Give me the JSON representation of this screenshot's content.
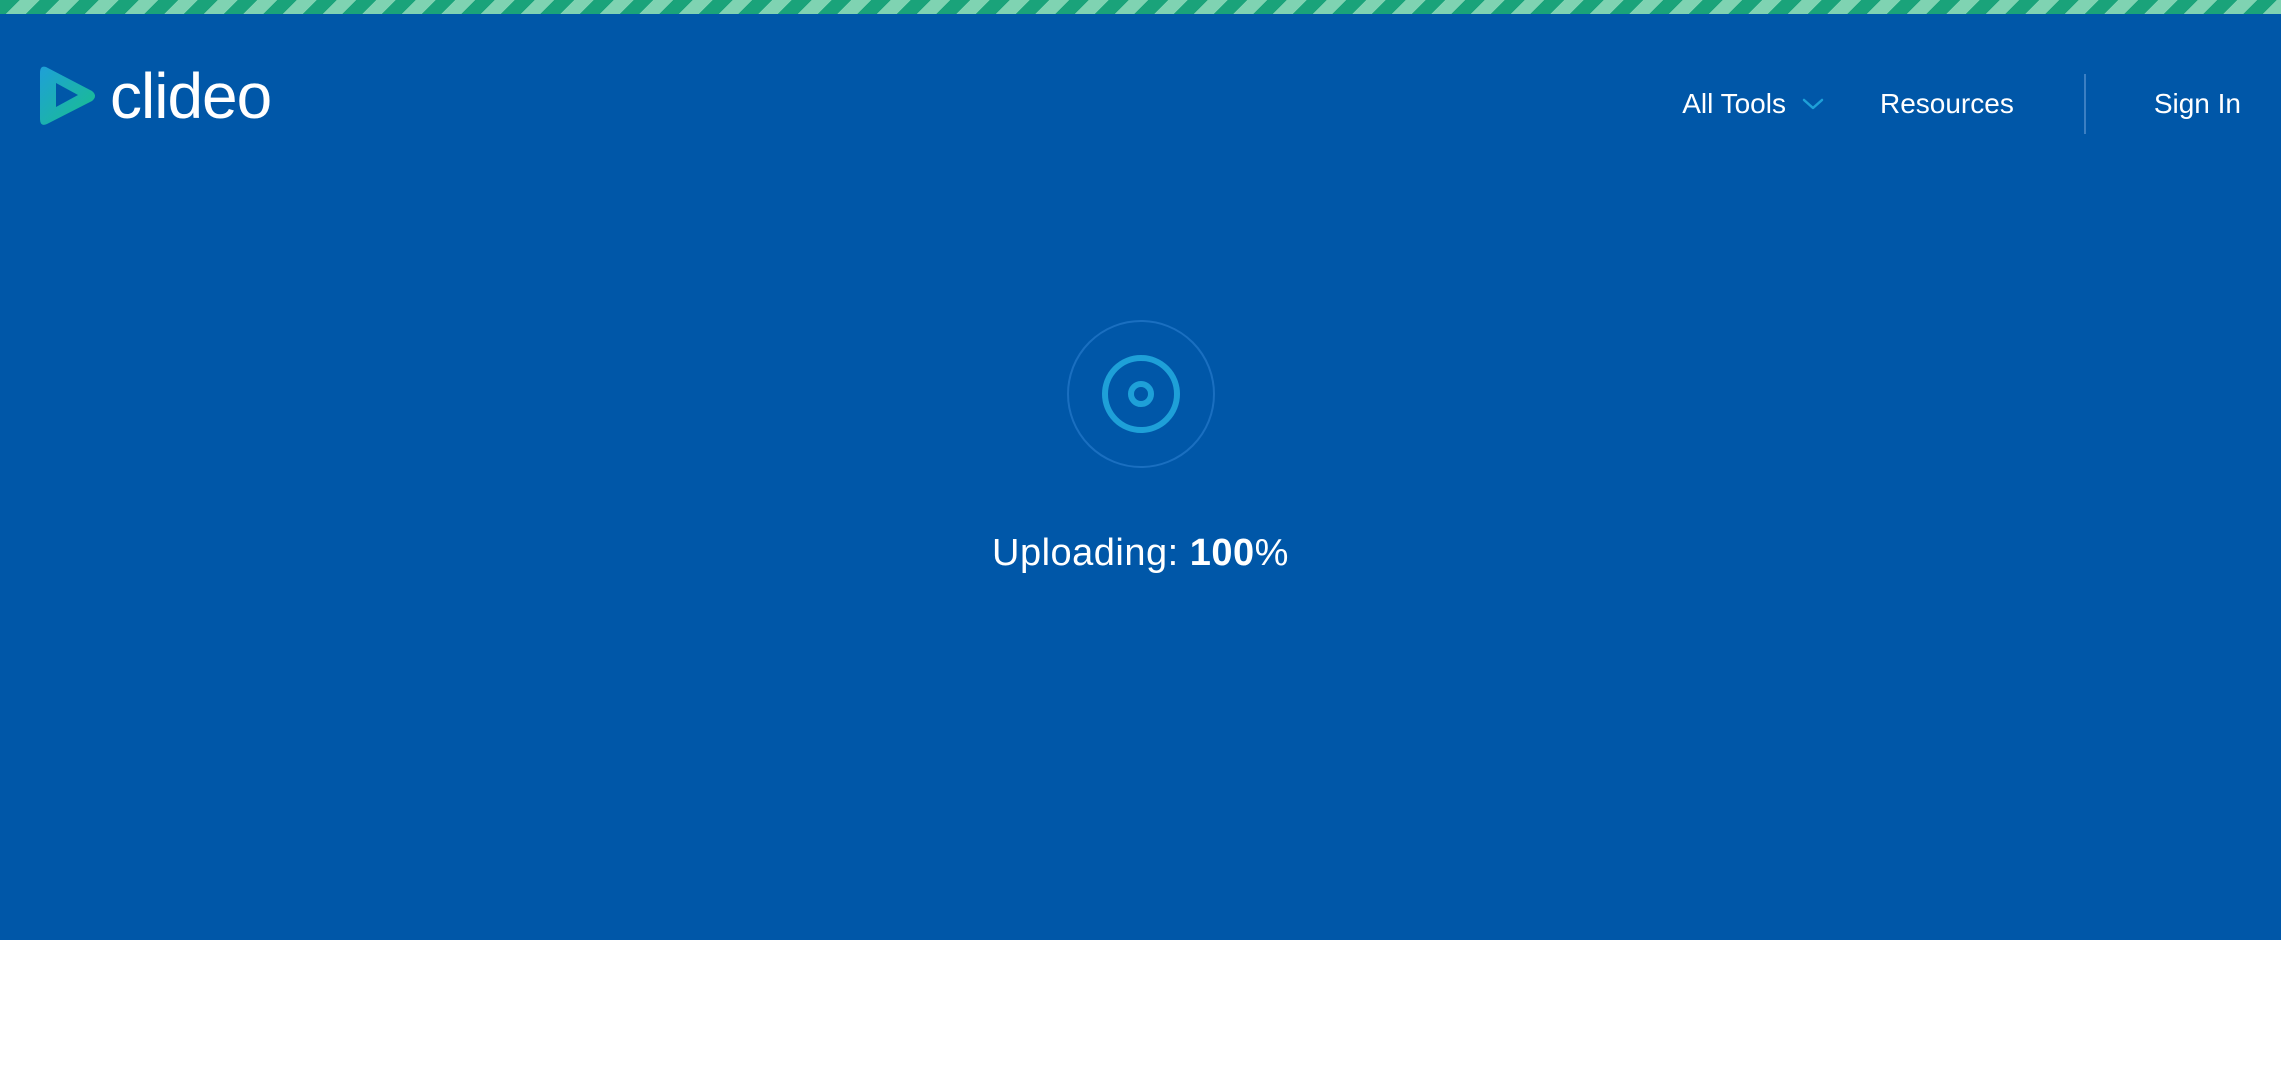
{
  "brand": {
    "name": "clideo",
    "logo_icon": "play-triangle-logo-icon",
    "colors": {
      "hero_background": "#0057a8",
      "stripe_dark": "#1aa37a",
      "stripe_light": "#7fd3b2",
      "accent": "#1ea0d8"
    }
  },
  "nav": {
    "all_tools_label": "All Tools",
    "all_tools_icon": "chevron-down-icon",
    "resources_label": "Resources",
    "sign_in_label": "Sign In"
  },
  "upload": {
    "icon": "upload-spinner-icon",
    "status_label": "Uploading: ",
    "progress_value": "100",
    "progress_unit": "%"
  }
}
